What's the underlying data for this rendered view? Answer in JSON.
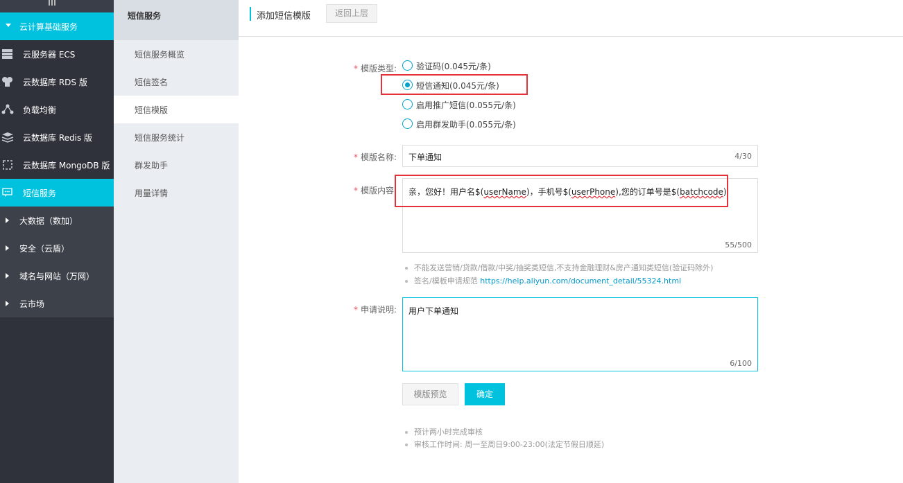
{
  "sidebar": {
    "group_open": "云计算基础服务",
    "items": [
      {
        "label": "云服务器 ECS",
        "icon": "server-icon"
      },
      {
        "label": "云数据库 RDS 版",
        "icon": "database-icon"
      },
      {
        "label": "负载均衡",
        "icon": "network-icon"
      },
      {
        "label": "云数据库 Redis 版",
        "icon": "stack-icon"
      },
      {
        "label": "云数据库 MongoDB 版",
        "icon": "gear-icon"
      },
      {
        "label": "短信服务",
        "icon": "chat-icon"
      }
    ],
    "groups": [
      "大数据（数加）",
      "安全（云盾）",
      "域名与网站（万网）",
      "云市场"
    ]
  },
  "subnav": {
    "title": "短信服务",
    "items": [
      "短信服务概览",
      "短信签名",
      "短信模版",
      "短信服务统计",
      "群发助手",
      "用量详情"
    ]
  },
  "header": {
    "title": "添加短信模版",
    "back": "返回上层"
  },
  "form": {
    "type_label": "模版类型:",
    "types": [
      "验证码(0.045元/条)",
      "短信通知(0.045元/条)",
      "启用推广短信(0.055元/条)",
      "启用群发助手(0.055元/条)"
    ],
    "name_label": "模版名称:",
    "name_value": "下单通知",
    "name_count": "4/30",
    "content_label": "模版内容",
    "content_parts": [
      "亲，您好！用户名$(",
      "userName",
      ")，手机号$(",
      "userPhone",
      "),您的订单号是$(",
      "batchcode",
      ")"
    ],
    "content_count": "55/500",
    "hint1": "不能发送营销/贷款/借款/中奖/抽奖类短信,不支持金融理财&房产通知类短信(验证码除外)",
    "hint2_prefix": "签名/模板申请规范",
    "hint2_link": "https://help.aliyun.com/document_detail/55324.html",
    "desc_label": "申请说明:",
    "desc_value": "用户下单通知",
    "desc_count": "6/100",
    "preview_btn": "模版预览",
    "ok_btn": "确定",
    "note1": "预计两小时完成审核",
    "note2": "审核工作时间: 周一至周日9:00-23:00(法定节假日顺延)"
  },
  "colors": {
    "accent": "#00c1de",
    "sidebar_bg": "#2f323a",
    "highlight": "#e5323a"
  }
}
